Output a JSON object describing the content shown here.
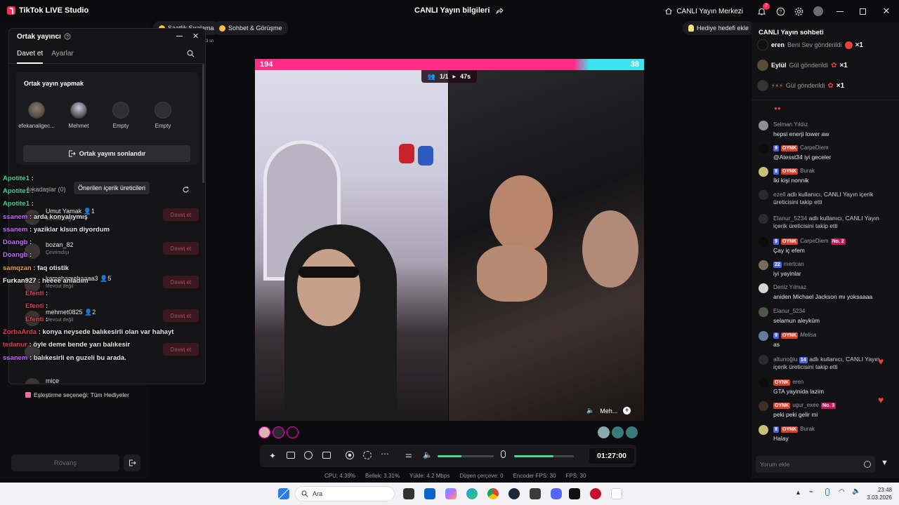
{
  "app": {
    "title": "TikTok LIVE Studio",
    "center_title": "CANLI Yayın bilgileri",
    "live_center": "CANLI Yayın Merkezi",
    "notif_count": "7"
  },
  "top_pills": {
    "ranking": "Saatlik Sıralama",
    "chat_meet": "Sohbet & Görüşme",
    "gift_goal": "Hediye hedefi ekle"
  },
  "cohost_panel": {
    "title": "Ortak yayıncı",
    "tabs": [
      "Davet et",
      "Ayarlar"
    ],
    "section_title": "Ortak yayın yapmak",
    "seats": [
      "efekanaligec...",
      "Mehmet",
      "Empty",
      "Empty"
    ],
    "end_button": "Ortak yayını sonlandır",
    "friends_tab": "Arkadaşlar (0)",
    "creators_tab": "Önerilen içerik üreticileri",
    "friends": [
      {
        "name": "Umut Yamak",
        "count": "1",
        "status": "Mevcut değil",
        "action": "Davet et"
      },
      {
        "name": "bozan_82",
        "count": "",
        "status": "Çevrimdışı",
        "action": "Davet et"
      },
      {
        "name": "kamehamehaaaa3",
        "count": "5",
        "status": "Mevcut değil",
        "action": "Davet et"
      },
      {
        "name": "mehmet0825",
        "count": "2",
        "status": "Mevcut değil",
        "action": "Davet et"
      },
      {
        "name": "",
        "count": "",
        "status": "",
        "action": "Davet et"
      },
      {
        "name": "miçe",
        "count": "",
        "status": "",
        "action": ""
      }
    ]
  },
  "side_labels": {
    "rank_small": "3 sn",
    "match_option": "Eşleştirme seçeneği: Tüm Hediyeler",
    "rematch": "Rövanş"
  },
  "overlay_chat": [
    {
      "user": "Apotite1",
      "text": ":",
      "color": "#46d6a0"
    },
    {
      "user": "Apotite1",
      "text": ":",
      "color": "#46d6a0"
    },
    {
      "user": "Apotite1",
      "text": ":",
      "color": "#46d6a0"
    },
    {
      "user": "ssanem",
      "text": ": arda konyalıymış",
      "color": "#c86bff"
    },
    {
      "user": "ssanem",
      "text": ": yaziklar klsun diyordum",
      "color": "#c86bff"
    },
    {
      "user": "Doangb",
      "text": ":",
      "color": "#c86bff"
    },
    {
      "user": "samqzan",
      "text": ": faq otistik",
      "color": "#f2a33a"
    },
    {
      "user": "Doangb",
      "text": ":",
      "color": "#c86bff"
    },
    {
      "user": "Furkan927",
      "text": ": heeee anladım",
      "color": "#ffffff"
    },
    {
      "user": "Efenti",
      "text": ":",
      "color": "#e63d5c"
    },
    {
      "user": "Efenti",
      "text": ":",
      "color": "#e63d5c"
    },
    {
      "user": "Efenti",
      "text": ":",
      "color": "#e63d5c"
    },
    {
      "user": "ZorbaArda",
      "text": ": konya neysede balıkesirli olan var hahayt",
      "color": "#e63d5c"
    },
    {
      "user": "tedanur",
      "text": ": öyle deme bende yarı balıkesir",
      "color": "#e63d5c"
    },
    {
      "user": "ssanem",
      "text": ": balıkesirli en guzeli bu arada.",
      "color": "#c86bff"
    }
  ],
  "battle": {
    "score_left": "194",
    "score_right": "38",
    "participants": "1/1",
    "time_left": "47s",
    "right_name": "Meh..."
  },
  "controls": {
    "timer": "01:27:00"
  },
  "stats": {
    "cpu": "CPU:  4.39%",
    "mem": "Bellek:  3.31%",
    "upload": "Yükle:  4.2 Mbps",
    "dropped": "Düşen çerçeve:  0",
    "encoder": "Encoder FPS:  30",
    "fps": "FPS:  30"
  },
  "chat": {
    "title": "CANLI Yayın sohbeti",
    "gifts": [
      {
        "user": "eren",
        "text": "Beni Sev gönderildi",
        "mult": "×1"
      },
      {
        "user": "Eylül",
        "text": "Gül gönderildi",
        "mult": "×1"
      },
      {
        "user": "",
        "text": "Gül gönderildi",
        "mult": "×1"
      }
    ],
    "messages": [
      {
        "user": "Selman Yıldız",
        "level": "",
        "tag": "",
        "no": "",
        "msg": "hepsi enerji lower aw"
      },
      {
        "user": "CarpeDiem",
        "level": "9",
        "tag": "OYNK",
        "no": "",
        "msg": "@Atesst34 iyi geceler"
      },
      {
        "user": "Burak",
        "level": "8",
        "tag": "OYNK",
        "no": "",
        "msg": "İki kişi nonnik"
      },
      {
        "user": "ezell",
        "level": "",
        "tag": "",
        "no": "",
        "msg": "adlı kullanıcı, CANLI Yayın içerik üreticisini takip etti"
      },
      {
        "user": "Elanur_5234",
        "level": "",
        "tag": "",
        "no": "",
        "msg": "adlı kullanıcı, CANLI Yayın içerik üreticisini takip etti"
      },
      {
        "user": "CarpeDiem",
        "level": "9",
        "tag": "OYNK",
        "no": "No. 2",
        "msg": "Çay iç efem"
      },
      {
        "user": "mertcan",
        "level": "22",
        "tag": "",
        "no": "",
        "msg": "iyi yayinlar"
      },
      {
        "user": "Deniz Yılmaz",
        "level": "",
        "tag": "",
        "no": "",
        "msg": "aniden Michael Jackson mı yoksaaaa"
      },
      {
        "user": "Elanur_5234",
        "level": "",
        "tag": "",
        "no": "",
        "msg": "selamun aleyküm"
      },
      {
        "user": "Melisa",
        "level": "9",
        "tag": "OYNK",
        "no": "",
        "msg": "as"
      },
      {
        "user": "altunoğlu",
        "level": "14",
        "tag": "",
        "no": "",
        "msg": "adlı kullanıcı, CANLI Yayın içerik üreticisini takip etti"
      },
      {
        "user": "eren",
        "level": "",
        "tag": "OYNK",
        "no": "",
        "msg": "GTA yayinida lazim"
      },
      {
        "user": "ugur_exee",
        "level": "",
        "tag": "OYNK",
        "no": "No. 3",
        "msg": "peki peki gelir mi"
      },
      {
        "user": "Burak",
        "level": "8",
        "tag": "OYNK",
        "no": "",
        "msg": "Halay"
      }
    ],
    "input_placeholder": "Yorum ekle"
  },
  "taskbar": {
    "search": "Ara",
    "time": "23:48",
    "date": "3.03.2026"
  }
}
